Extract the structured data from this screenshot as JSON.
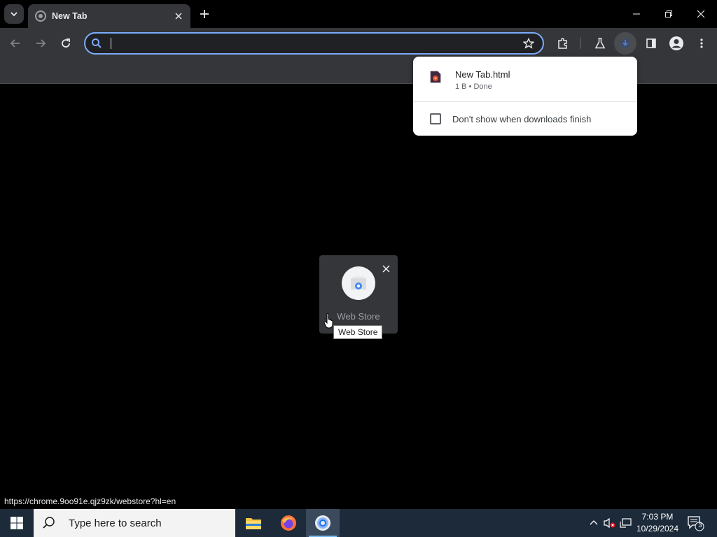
{
  "browser": {
    "tab": {
      "title": "New Tab"
    },
    "omnibox": {
      "value": "",
      "placeholder": ""
    },
    "status_url": "https://chrome.9oo91e.qjz9zk/webstore?hl=en"
  },
  "download_bubble": {
    "items": [
      {
        "filename": "New Tab.html",
        "status": "1 B • Done"
      }
    ],
    "checkbox_label": "Don't show when downloads finish",
    "checkbox_checked": false
  },
  "new_tab": {
    "shortcuts": [
      {
        "title": "Web Store",
        "tooltip": "Web Store"
      }
    ]
  },
  "taskbar": {
    "search_placeholder": "Type here to search",
    "apps": [
      {
        "name": "File Explorer"
      },
      {
        "name": "Firefox"
      },
      {
        "name": "Chrome",
        "active": true
      }
    ],
    "clock": {
      "time": "7:03 PM",
      "date": "10/29/2024"
    },
    "notification_count": "3"
  },
  "colors": {
    "accent": "#7cacf8",
    "toolbar_bg": "#35363a",
    "taskbar_bg": "#1c2a3a"
  }
}
